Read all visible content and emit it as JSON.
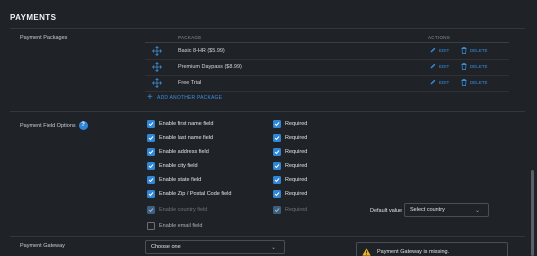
{
  "section": {
    "title": "PAYMENTS"
  },
  "packages": {
    "label": "Payment Packages",
    "col_package": "PACKAGE",
    "col_actions": "ACTIONS",
    "items": [
      {
        "name": "Basic 8-HR ($5.99)",
        "edit": "EDIT",
        "delete": "DELETE"
      },
      {
        "name": "Premium Daypass ($8.99)",
        "edit": "EDIT",
        "delete": "DELETE"
      },
      {
        "name": "Free Trial",
        "edit": "EDIT",
        "delete": "DELETE"
      }
    ],
    "add_label": "ADD ANOTHER PACKAGE"
  },
  "field_options": {
    "label": "Payment Field Options",
    "help_icon": "?",
    "fields": [
      {
        "label": "Enable first name field",
        "enabled": true,
        "required_label": "Required",
        "required": true
      },
      {
        "label": "Enable last name field",
        "enabled": true,
        "required_label": "Required",
        "required": true
      },
      {
        "label": "Enable address field",
        "enabled": true,
        "required_label": "Required",
        "required": true
      },
      {
        "label": "Enable city field",
        "enabled": true,
        "required_label": "Required",
        "required": true
      },
      {
        "label": "Enable state field",
        "enabled": true,
        "required_label": "Required",
        "required": true
      },
      {
        "label": "Enable Zip / Postal Code field",
        "enabled": true,
        "required_label": "Required",
        "required": true
      },
      {
        "label": "Enable country field",
        "enabled": true,
        "required_label": "Required",
        "required": true
      },
      {
        "label": "Enable email field",
        "enabled": false
      }
    ],
    "default_value_label": "Default value",
    "default_value_select": "Select country"
  },
  "gateway": {
    "label": "Payment Gateway",
    "select_value": "Choose one",
    "warning": "Payment Gateway is missing."
  },
  "colors": {
    "accent": "#2f86d6",
    "link": "#3b8fe0",
    "warning": "#f0b323",
    "background": "#1f2226"
  }
}
